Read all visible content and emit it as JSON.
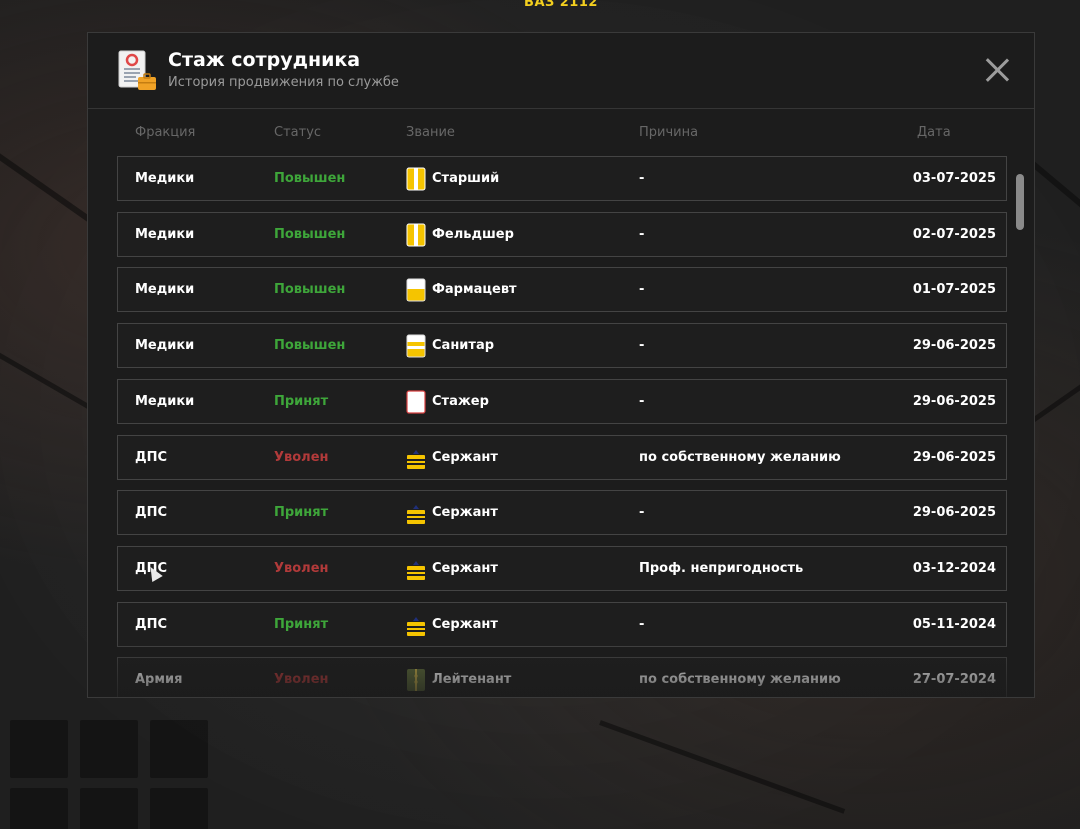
{
  "vehicle_label": "ВАЗ 2112",
  "modal": {
    "title": "Стаж сотрудника",
    "subtitle": "История продвижения по службе",
    "header_icon": "document-briefcase-icon",
    "close_icon": "close-icon"
  },
  "columns": {
    "faction": "Фракция",
    "status": "Статус",
    "rank": "Звание",
    "reason": "Причина",
    "date": "Дата"
  },
  "colors": {
    "accent_yellow": "#f3cf1f",
    "status_green": "#3ea63a",
    "status_red": "#b23a3a",
    "row_border": "#444444"
  },
  "rows": [
    {
      "faction": "Медики",
      "status": "Повышен",
      "status_type": "green",
      "rank_icon": "medic-badge-yellow-icon",
      "rank": "Старший",
      "reason": "-",
      "date": "03-07-2025"
    },
    {
      "faction": "Медики",
      "status": "Повышен",
      "status_type": "green",
      "rank_icon": "medic-badge-yellow-icon",
      "rank": "Фельдшер",
      "reason": "-",
      "date": "02-07-2025"
    },
    {
      "faction": "Медики",
      "status": "Повышен",
      "status_type": "green",
      "rank_icon": "medic-badge-half-icon",
      "rank": "Фармацевт",
      "reason": "-",
      "date": "01-07-2025"
    },
    {
      "faction": "Медики",
      "status": "Повышен",
      "status_type": "green",
      "rank_icon": "medic-badge-stripes-icon",
      "rank": "Санитар",
      "reason": "-",
      "date": "29-06-2025"
    },
    {
      "faction": "Медики",
      "status": "Принят",
      "status_type": "green",
      "rank_icon": "medic-badge-white-icon",
      "rank": "Стажер",
      "reason": "-",
      "date": "29-06-2025"
    },
    {
      "faction": "ДПС",
      "status": "Уволен",
      "status_type": "red",
      "rank_icon": "police-shoulder-strap-icon",
      "rank": "Сержант",
      "reason": "по собственному желанию",
      "date": "29-06-2025"
    },
    {
      "faction": "ДПС",
      "status": "Принят",
      "status_type": "green",
      "rank_icon": "police-shoulder-strap-icon",
      "rank": "Сержант",
      "reason": "-",
      "date": "29-06-2025"
    },
    {
      "faction": "ДПС",
      "status": "Уволен",
      "status_type": "red",
      "rank_icon": "police-shoulder-strap-icon",
      "rank": "Сержант",
      "reason": "Проф. непригодность",
      "date": "03-12-2024"
    },
    {
      "faction": "ДПС",
      "status": "Принят",
      "status_type": "green",
      "rank_icon": "police-shoulder-strap-icon",
      "rank": "Сержант",
      "reason": "-",
      "date": "05-11-2024"
    },
    {
      "faction": "Армия",
      "status": "Уволен",
      "status_type": "red",
      "rank_icon": "army-shoulder-strap-icon",
      "rank": "Лейтенант",
      "reason": "по собственному желанию",
      "date": "27-07-2024"
    }
  ]
}
